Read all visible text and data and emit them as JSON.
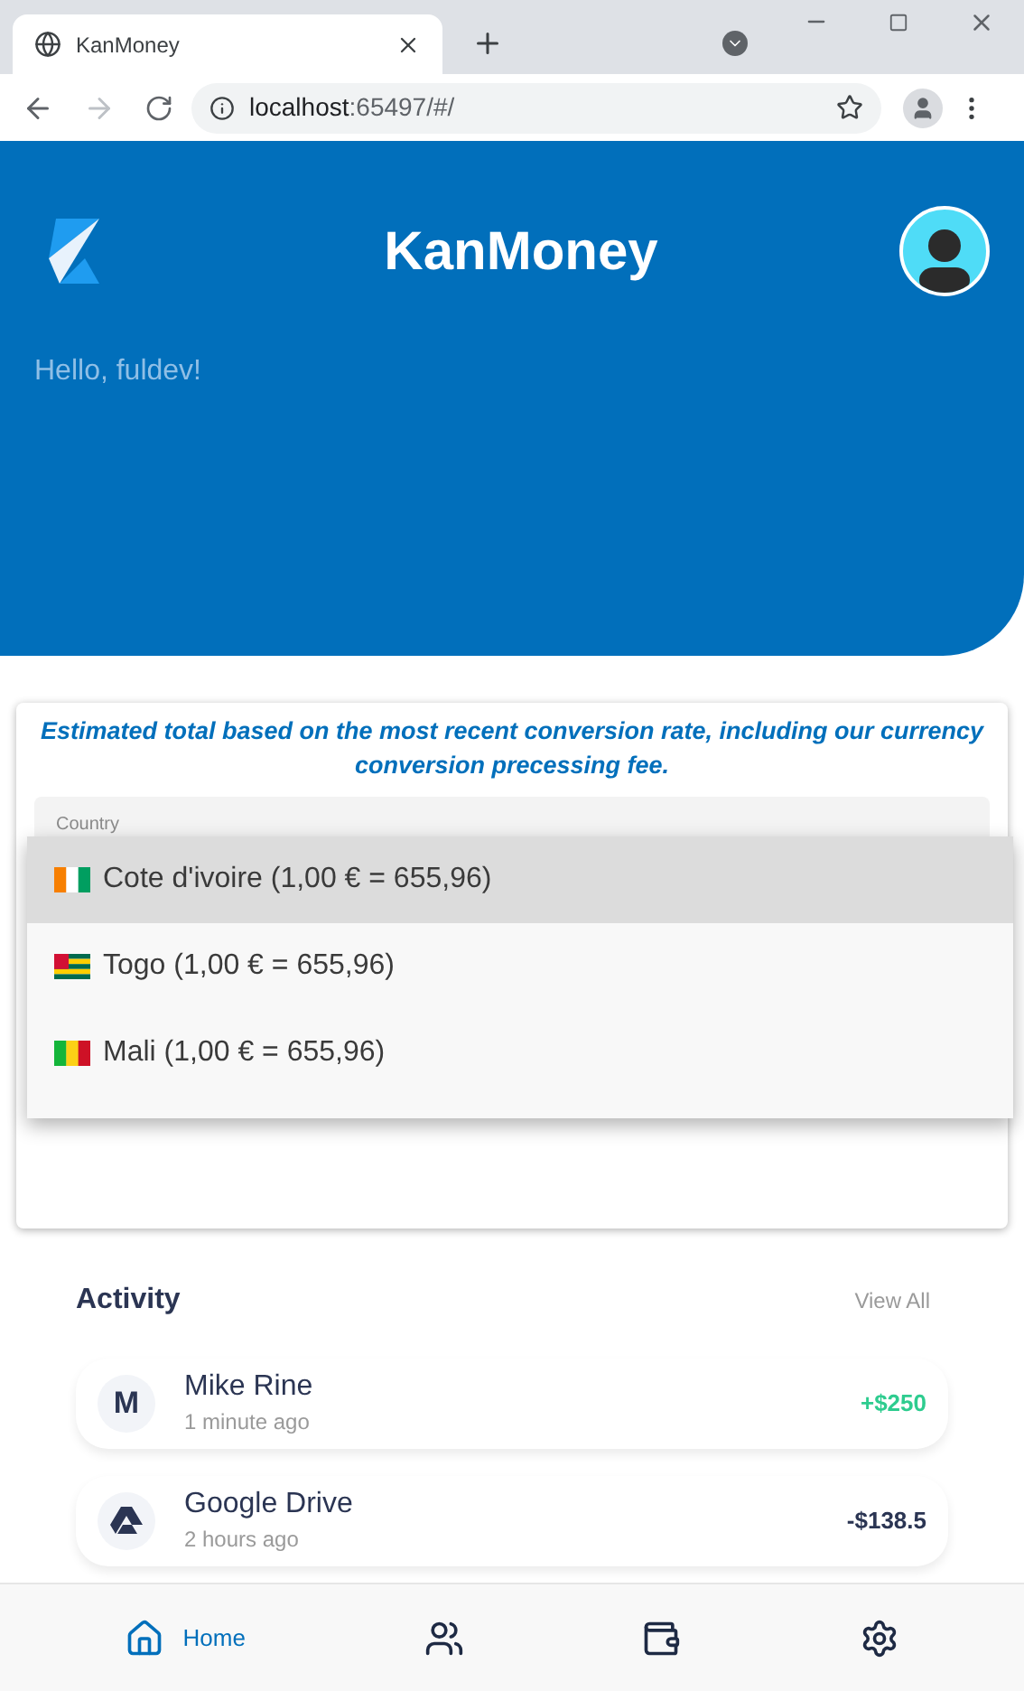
{
  "browser": {
    "tab_title": "KanMoney",
    "url_host": "localhost",
    "url_rest": ":65497/#/"
  },
  "header": {
    "title": "KanMoney",
    "greeting": "Hello, fuldev!"
  },
  "card": {
    "note": "Estimated total based on the most recent conversion rate, including our currency conversion precessing fee.",
    "field_label": "Country"
  },
  "dropdown": [
    {
      "kind": "ivorian",
      "label": "Cote d'ivoire (1,00 € = 655,96)",
      "selected": true
    },
    {
      "kind": "togolese",
      "label": "Togo (1,00 € = 655,96)",
      "selected": false
    },
    {
      "kind": "malian",
      "label": "Mali (1,00 € = 655,96)",
      "selected": false
    }
  ],
  "activity": {
    "title": "Activity",
    "view_all": "View All",
    "items": [
      {
        "kind": "letter",
        "avatar": "M",
        "name": "Mike Rine",
        "time": "1 minute ago",
        "amount": "+$250",
        "color": "#2ecc8f"
      },
      {
        "kind": "drive",
        "name": "Google Drive",
        "time": "2 hours ago",
        "amount": "-$138.5",
        "color": "#2b3553"
      }
    ]
  },
  "nav": [
    {
      "kind": "home",
      "label": "Home",
      "selected": true
    },
    {
      "kind": "people",
      "selected": false
    },
    {
      "kind": "wallet",
      "selected": false
    },
    {
      "kind": "settings",
      "selected": false
    }
  ]
}
